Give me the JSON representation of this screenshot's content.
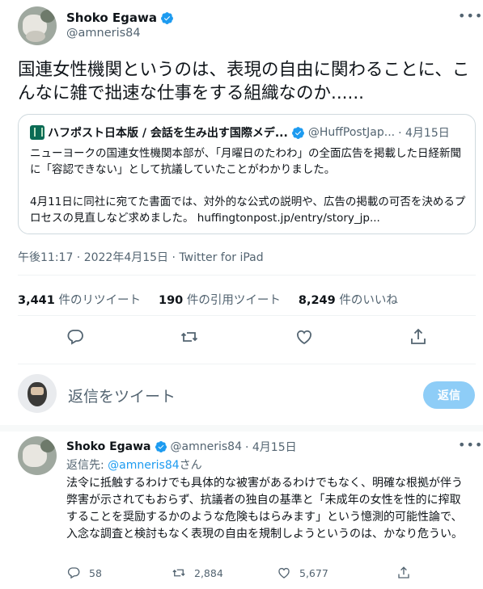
{
  "tweet": {
    "author_name": "Shoko Egawa",
    "author_handle": "@amneris84",
    "text": "国連女性機関というのは、表現の自由に関わることに、こんなに雑で拙速な仕事をする組織なのか......",
    "meta": "午後11:17 · 2022年4月15日 · Twitter for iPad"
  },
  "quote": {
    "name": "ハフポスト日本版 / 会話を生み出す国際メデ...",
    "handle": "@HuffPostJap...",
    "date": "· 4月15日",
    "para1": "ニューヨークの国連女性機関本部が、「月曜日のたわわ」の全面広告を掲載した日経新聞に「容認できない」として抗議していたことがわかりました。",
    "para2": "4月11日に同社に宛てた書面では、対外的な公式の説明や、広告の掲載の可否を決めるプロセスの見直しなど求めました。",
    "link": "huffingtonpost.jp/entry/story_jp..."
  },
  "stats": {
    "retweets_count": "3,441",
    "retweets_label": "件のリツイート",
    "quotes_count": "190",
    "quotes_label": "件の引用ツイート",
    "likes_count": "8,249",
    "likes_label": "件のいいね"
  },
  "composer": {
    "placeholder": "返信をツイート",
    "button": "返信"
  },
  "reply": {
    "author_name": "Shoko Egawa",
    "author_handle": "@amneris84",
    "date": "· 4月15日",
    "replying_to_prefix": "返信先: ",
    "replying_to_handle": "@amneris84",
    "replying_to_suffix": "さん",
    "text": "法令に抵触するわけでも具体的な被害があるわけでもなく、明確な根拠が伴う弊害が示されてもおらず、抗議者の独自の基準と「未成年の女性を性的に搾取することを奨励するかのような危険もはらみます」という憶測的可能性論で、入念な調査と検討もなく表現の自由を規制しようというのは、かなり危うい。",
    "reply_count": "58",
    "retweet_count": "2,884",
    "like_count": "5,677"
  },
  "colors": {
    "accent": "#1d9bf0",
    "muted": "#536471",
    "button_disabled": "#8ecdf7"
  },
  "icons": [
    "more-icon",
    "verified-icon",
    "reply-icon",
    "retweet-icon",
    "like-icon",
    "share-icon"
  ]
}
